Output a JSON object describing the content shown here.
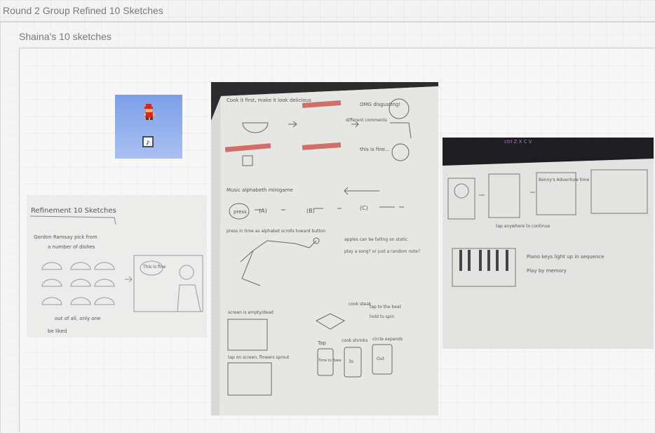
{
  "board": {
    "title": "Round 2 Group Refined 10 Sketches"
  },
  "group": {
    "title": "Shaina's 10 sketches"
  },
  "sketches": {
    "sprite": {
      "icon": "mario-sprite-icon"
    },
    "refinement": {
      "heading": "Refinement 10 Sketches",
      "line1": "Gordon Ramsay pick from",
      "line2": "a number of dishes",
      "bubble": "This is fine",
      "footer1": "out of all, only one",
      "footer2": "be liked"
    },
    "notebook": {
      "top_note": "Cook it first, make it look delicious",
      "omg": "OMG disgusting!",
      "different": "different comments",
      "fine": "this is fine...",
      "music_alphabet": "Music alphabeth minigame",
      "press": "press",
      "btn_a": "(A)",
      "btn_b": "(B)",
      "btn_c": "(C)",
      "press_in_time": "press in time as alphabet scrolls toward button",
      "apples": "apples can be falling on static",
      "play_song": "play a song? or just a random note?",
      "screen_empty": "screen is empty/dead",
      "cook_steak": "cook steak",
      "tap_beat": "tap to the beat",
      "hold_spin": "hold to spin",
      "tap_on_screen": "tap on screen, flowers sprout",
      "tap": "Tap",
      "cook_shrinks": "cook shrinks",
      "circle_expands": "circle expands",
      "time_to_bake": "Time to Bake",
      "label_3s": "3s",
      "label_out": "Out"
    },
    "piano": {
      "keys": "ctrl  Z  X  C  V",
      "ctrl": "ctrl",
      "tap_anywhere": "tap anywhere to continue",
      "adventure": "Benny's Adventure time",
      "note1": "Piano keys light up in sequence",
      "note2": "Play by memory"
    }
  },
  "colors": {
    "accent_red": "#c8453f",
    "sprite_sky": "#8aa8ec",
    "paper": "#e9e9e6"
  }
}
